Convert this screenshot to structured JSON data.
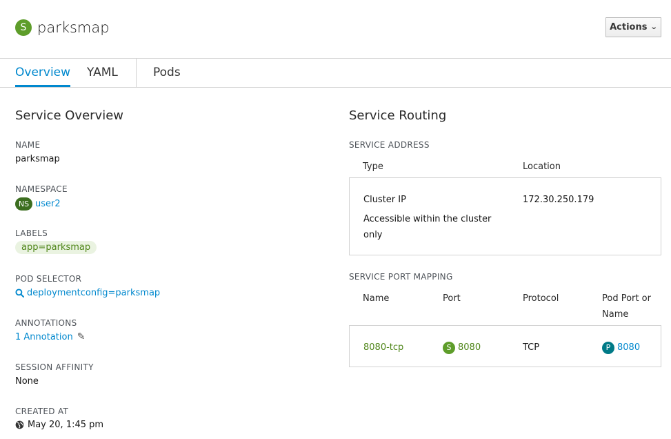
{
  "header": {
    "badge": "S",
    "title": "parksmap",
    "actions_label": "Actions"
  },
  "tabs": [
    {
      "label": "Overview",
      "active": true
    },
    {
      "label": "YAML",
      "active": false
    },
    {
      "label": "Pods",
      "active": false
    }
  ],
  "overview": {
    "title": "Service Overview",
    "name_label": "NAME",
    "name_value": "parksmap",
    "namespace_label": "NAMESPACE",
    "namespace_badge": "NS",
    "namespace_value": "user2",
    "labels_label": "LABELS",
    "labels_chip": "app=parksmap",
    "pod_selector_label": "POD SELECTOR",
    "pod_selector_value": "deploymentconfig=parksmap",
    "annotations_label": "ANNOTATIONS",
    "annotations_value": "1 Annotation",
    "session_affinity_label": "SESSION AFFINITY",
    "session_affinity_value": "None",
    "created_at_label": "CREATED AT",
    "created_at_value": "May 20, 1:45 pm"
  },
  "routing": {
    "title": "Service Routing",
    "address_label": "SERVICE ADDRESS",
    "address_cols": [
      "Type",
      "Location"
    ],
    "address_type": "Cluster IP",
    "address_desc_line1": "Accessible within the cluster",
    "address_desc_line2": "only",
    "address_location": "172.30.250.179",
    "port_mapping_label": "SERVICE PORT MAPPING",
    "port_cols": [
      "Name",
      "Port",
      "Protocol",
      "Pod Port or",
      "Name"
    ],
    "port_row": {
      "name": "8080-tcp",
      "port_badge": "S",
      "port": "8080",
      "protocol": "TCP",
      "pod_badge": "P",
      "pod_port": "8080"
    }
  },
  "colors": {
    "accent": "#0088ce",
    "service_badge": "#5e9d2a",
    "namespace_badge": "#3c6e20",
    "pod_badge": "#007a87"
  }
}
